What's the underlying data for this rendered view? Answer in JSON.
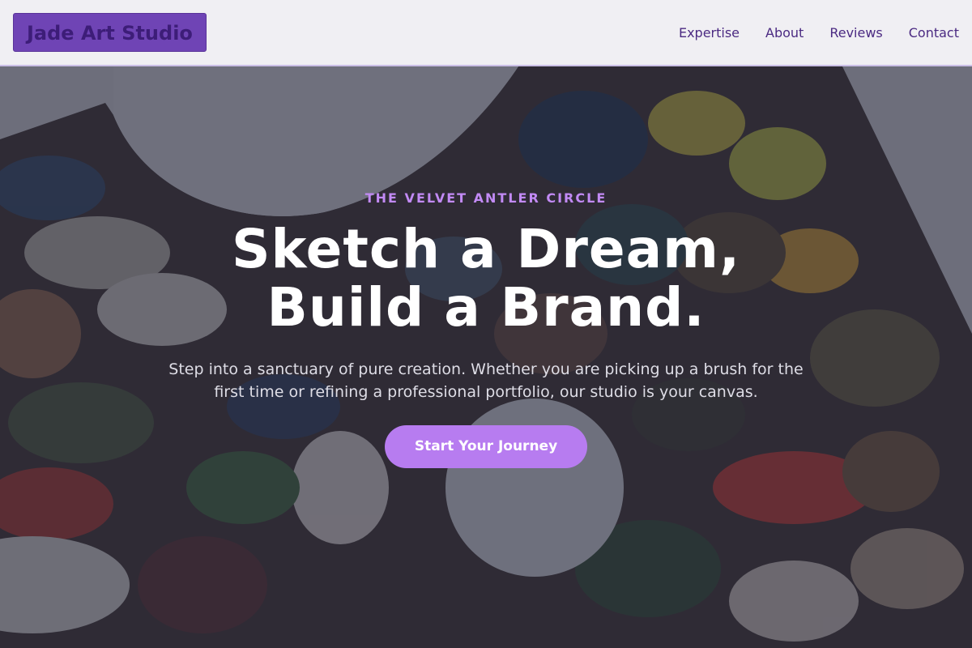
{
  "header": {
    "logo": "Jade Art Studio",
    "nav": [
      "Expertise",
      "About",
      "Reviews",
      "Contact"
    ]
  },
  "hero": {
    "eyebrow": "THE VELVET ANTLER CIRCLE",
    "headline_line1": "Sketch a Dream,",
    "headline_line2": "Build a Brand.",
    "subtext_line1": "Step into a sanctuary of pure creation. Whether you are picking up a brush for the",
    "subtext_line2": "first time or refining a professional portfolio, our studio is your canvas.",
    "cta_label": "Start Your Journey"
  },
  "colors": {
    "accent": "#b77cf0",
    "logo_bg": "#6f44b5",
    "nav_text": "#4b2a82",
    "header_bg": "#f0eff3"
  }
}
